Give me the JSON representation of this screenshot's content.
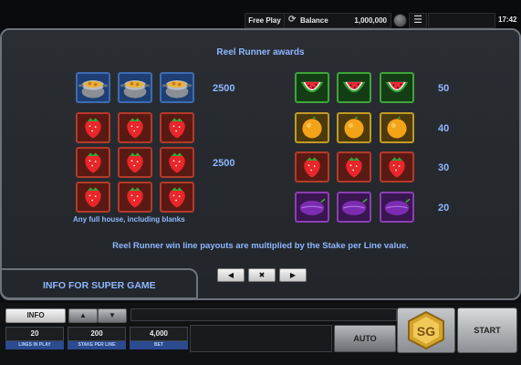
{
  "topbar": {
    "free_play": "Free Play",
    "balance_label": "Balance",
    "balance_value": "1,000,000",
    "clock": "17:42"
  },
  "awards": {
    "title": "Reel Runner awards",
    "left_group": {
      "rows": [
        {
          "symbol": "pot",
          "count": 3,
          "payout": "2500"
        },
        {
          "symbol": "strawberry-block",
          "count": 9,
          "payout": "2500"
        }
      ],
      "note": "Any full house, including blanks"
    },
    "right_group": [
      {
        "symbol": "watermelon",
        "count": 3,
        "payout": "50"
      },
      {
        "symbol": "orange",
        "count": 3,
        "payout": "40"
      },
      {
        "symbol": "strawberry",
        "count": 3,
        "payout": "30"
      },
      {
        "symbol": "plum",
        "count": 3,
        "payout": "20"
      }
    ],
    "footnote": "Reel Runner win line payouts are multiplied by the Stake per Line value."
  },
  "info_super_game": "INFO FOR SUPER GAME",
  "nav": {
    "prev_icon": "chevron-left-icon",
    "close_icon": "close-icon",
    "next_icon": "chevron-right-icon"
  },
  "controls": {
    "info_label": "INFO",
    "lines_value": "20",
    "lines_label": "LINES IN PLAY",
    "stake_value": "200",
    "stake_label": "STAKE PER LINE",
    "bet_value": "4,000",
    "bet_label": "BET",
    "auto_label": "AUTO",
    "logo_text": "SG",
    "start_label": "START"
  },
  "colors": {
    "accent_text": "#8fb6ff",
    "panel_border": "#6d737a",
    "label_strip": "#2b4a8f"
  }
}
